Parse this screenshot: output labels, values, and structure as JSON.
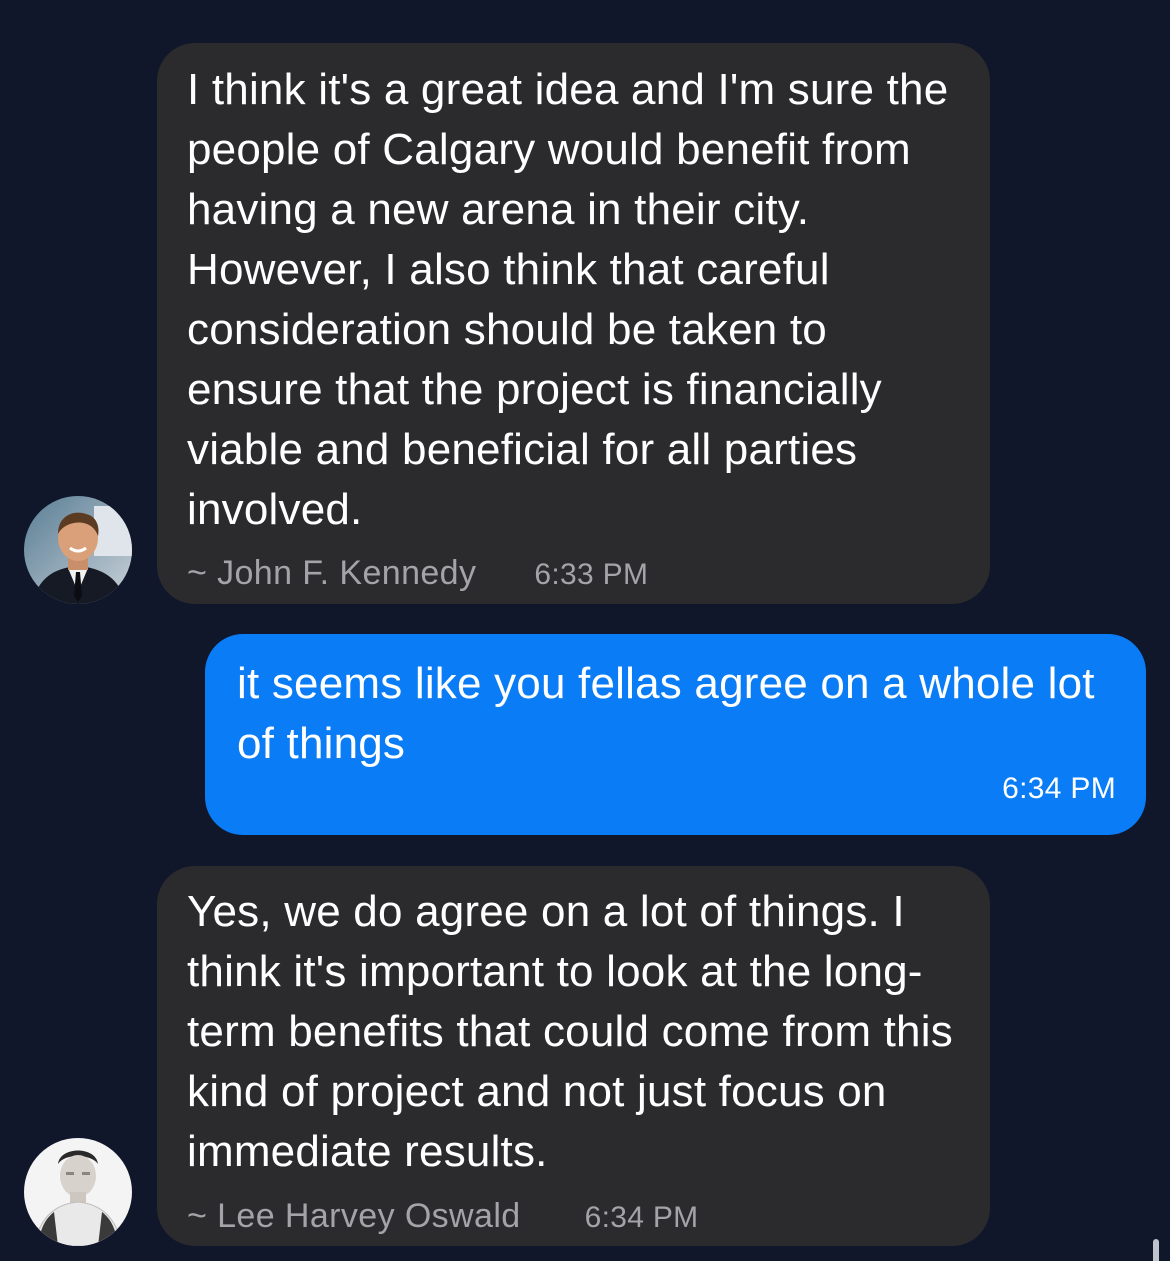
{
  "messages": [
    {
      "direction": "incoming",
      "text": "I think it's a great idea and I'm sure the people of Calgary would benefit from having a new arena in their city. However, I also think that careful consideration should be taken to ensure that the project is financially viable and beneficial for all parties involved.",
      "sender": "~ John F. Kennedy",
      "time": "6:33 PM",
      "avatar_icon": "man-in-suit-avatar"
    },
    {
      "direction": "outgoing",
      "text": "it seems like you fellas agree on a whole lot of things",
      "time": "6:34 PM"
    },
    {
      "direction": "incoming",
      "text": "Yes, we do agree on a lot of things. I think it's important to look at the long-term benefits that could come from this kind of project and not just focus on immediate results.",
      "sender": "~ Lee Harvey Oswald",
      "time": "6:34 PM",
      "avatar_icon": "man-in-white-shirt-avatar"
    }
  ],
  "colors": {
    "background": "#10172a",
    "incoming_bubble": "#2b2b2d",
    "outgoing_bubble": "#0a7cf6",
    "meta_text": "#a3a3a8"
  }
}
